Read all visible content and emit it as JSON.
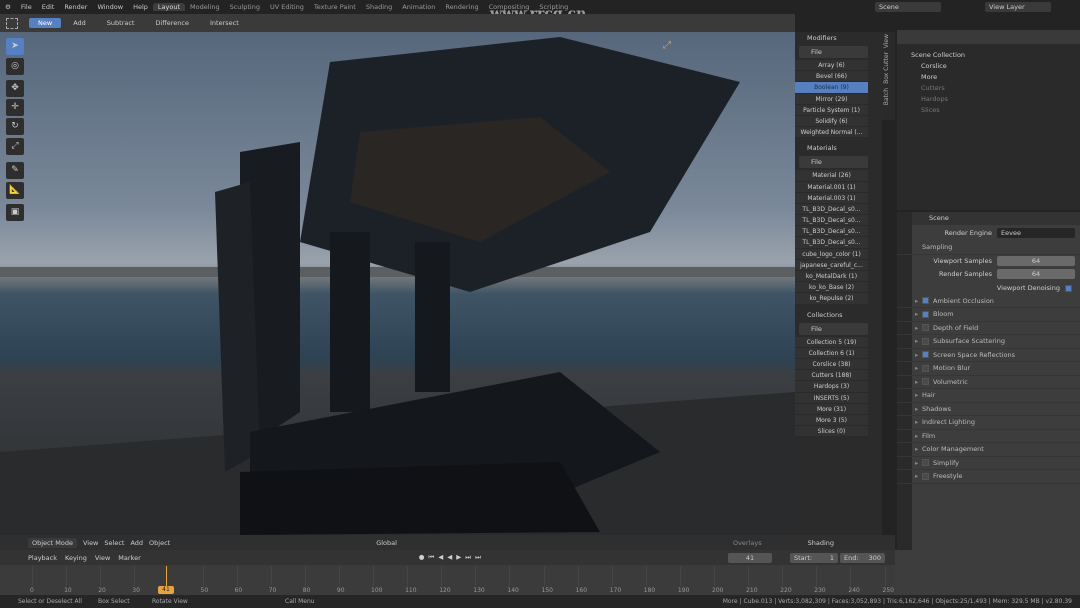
{
  "topbar": {
    "menus": [
      "File",
      "Edit",
      "Render",
      "Window",
      "Help"
    ],
    "workspaces": [
      "Layout",
      "Modeling",
      "Sculpting",
      "UV Editing",
      "Texture Paint",
      "Shading",
      "Animation",
      "Rendering",
      "Compositing",
      "Scripting"
    ],
    "active_workspace": "Layout",
    "scene": "Scene",
    "view_layer": "View Layer"
  },
  "watermark": "www.rrcg.cn",
  "tool_header": {
    "modes": [
      "New",
      "Add",
      "Subtract",
      "Difference",
      "Intersect"
    ],
    "active": "New"
  },
  "toolbar": {
    "tools": [
      "select-box-icon",
      "cursor-icon",
      "select-icon",
      "move-icon",
      "rotate-icon",
      "scale-icon",
      "annotate-icon",
      "measure-icon",
      "transform-icon"
    ]
  },
  "viewport_header": {
    "mode": "Object Mode",
    "menus": [
      "View",
      "Select",
      "Add",
      "Object"
    ],
    "orientation": "Global",
    "overlays": "Overlays",
    "shading": "Shading"
  },
  "npanel": {
    "modifiers_title": "Modifiers",
    "file_label": "File",
    "modifiers": [
      "Array (6)",
      "Bevel (66)",
      "Boolean (9)",
      "Mirror (29)",
      "Particle System (1)",
      "Solidify (6)",
      "Weighted Normal (..."
    ],
    "selected_modifier": "Boolean (9)",
    "materials_title": "Materials",
    "materials": [
      "Material (26)",
      "Material.001 (1)",
      "Material.003 (1)",
      "TL_B3D_Decal_s0...",
      "TL_B3D_Decal_s0...",
      "TL_B3D_Decal_s0...",
      "TL_B3D_Decal_s0...",
      "cube_logo_color (1)",
      "japanese_careful_c...",
      "ko_MetalDark (1)",
      "ko_ko_Base (2)",
      "ko_Repulse (2)"
    ],
    "collections_title": "Collections",
    "collections": [
      "Collection 5 (19)",
      "Collection 6 (1)",
      "Corslice (38)",
      "Cutters (188)",
      "Hardops (3)",
      "INSERTS (5)",
      "More (31)",
      "More 3 (5)",
      "Slices (0)"
    ],
    "tabs": [
      "View",
      "Box Cutter",
      "Batch"
    ]
  },
  "outliner": {
    "root": "Scene Collection",
    "items": [
      "Corslice",
      "More",
      "Cutters",
      "Hardops",
      "Slices"
    ]
  },
  "properties": {
    "header": "Scene",
    "render_engine_label": "Render Engine",
    "render_engine": "Eevee",
    "sampling": "Sampling",
    "viewport_samples_label": "Viewport Samples",
    "viewport_samples": "64",
    "render_samples_label": "Render Samples",
    "render_samples": "64",
    "viewport_denoising": "Viewport Denoising",
    "panels": [
      {
        "label": "Ambient Occlusion",
        "check": true
      },
      {
        "label": "Bloom",
        "check": true
      },
      {
        "label": "Depth of Field",
        "check": false
      },
      {
        "label": "Subsurface Scattering",
        "check": false
      },
      {
        "label": "Screen Space Reflections",
        "check": true
      },
      {
        "label": "Motion Blur",
        "check": false
      },
      {
        "label": "Volumetric",
        "check": false
      },
      {
        "label": "Hair"
      },
      {
        "label": "Shadows"
      },
      {
        "label": "Indirect Lighting"
      },
      {
        "label": "Film"
      },
      {
        "label": "Color Management"
      },
      {
        "label": "Simplify",
        "check": false
      },
      {
        "label": "Freestyle",
        "check": false
      }
    ]
  },
  "timeline": {
    "menus": [
      "Playback",
      "Keying",
      "View",
      "Marker"
    ],
    "current_frame": "41",
    "start_label": "Start:",
    "start": "1",
    "end_label": "End:",
    "end": "300",
    "ticks": [
      "0",
      "10",
      "20",
      "30",
      "50",
      "60",
      "70",
      "80",
      "90",
      "100",
      "110",
      "120",
      "130",
      "140",
      "150",
      "160",
      "170",
      "180",
      "190",
      "200",
      "210",
      "220",
      "230",
      "240",
      "250"
    ]
  },
  "statusbar": {
    "left": [
      "Select or Deselect All",
      "Box Select",
      "Rotate View",
      "Call Menu"
    ],
    "stats": "More | Cube.013 | Verts:3,082,309 | Faces:3,052,893 | Tris:6,162,646 | Objects:25/1,493 | Mem: 329.5 MB | v2.80.39"
  },
  "colors": {
    "accent": "#5680c2",
    "frame": "#e8a33c"
  }
}
